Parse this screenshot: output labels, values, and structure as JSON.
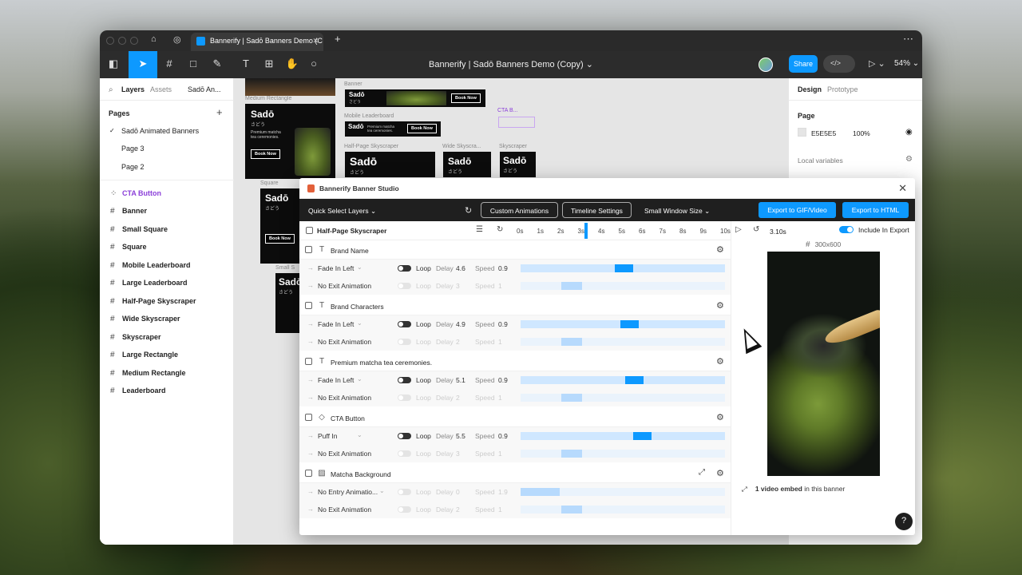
{
  "browser": {
    "tab_title": "Bannerify | Sadō Banners Demo (C",
    "tab_close": "✕",
    "new_tab": "+",
    "more": "⋯"
  },
  "toolbar": {
    "doc_title": "Bannerify | Sadō Banners Demo (Copy) ⌄",
    "share": "Share",
    "code": "</>",
    "zoom": "54% ⌄"
  },
  "left_panel": {
    "tabs": [
      "Layers",
      "Assets",
      "Sadō An..."
    ],
    "pages_title": "Pages",
    "pages": [
      "Sadō Animated Banners",
      "Page 3",
      "Page 2"
    ],
    "layers": [
      "CTA Button",
      "Banner",
      "Small Square",
      "Square",
      "Mobile Leaderboard",
      "Large Leaderboard",
      "Half-Page Skyscraper",
      "Wide Skyscraper",
      "Skyscraper",
      "Large Rectangle",
      "Medium Rectangle",
      "Leaderboard"
    ]
  },
  "canvas": {
    "labels": {
      "medium_rectangle": "Medium Rectangle",
      "banner": "Banner",
      "mobile_leaderboard": "Mobile Leaderboard",
      "half_page": "Half-Page Skyscraper",
      "wide_sky": "Wide Skyscra...",
      "skyscraper": "Skyscraper",
      "square": "Square",
      "small_sq": "Small S",
      "cta": "CTA B..."
    },
    "brand": "Sadō",
    "brand_sub": "さどう",
    "tagline": "Premium matcha tea ceremonies.",
    "book_now": "Book Now"
  },
  "right_panel": {
    "tabs": [
      "Design",
      "Prototype"
    ],
    "page_title": "Page",
    "bg_hex": "E5E5E5",
    "bg_opacity": "100%",
    "local_vars": "Local variables"
  },
  "studio": {
    "title": "Bannerify Banner Studio",
    "quick_select": "Quick Select Layers ⌄",
    "custom_animations": "Custom Animations",
    "timeline_settings": "Timeline Settings",
    "window_size": "Small Window Size ⌄",
    "export_gif": "Export to GIF/Video",
    "export_html": "Export to HTML",
    "timeline_name": "Half-Page Skyscraper",
    "ticks": [
      "0s",
      "1s",
      "2s",
      "3s",
      "4s",
      "5s",
      "6s",
      "7s",
      "8s",
      "9s",
      "10s"
    ],
    "current_time": "3.10s",
    "include_export": "Include In Export",
    "layers": [
      {
        "name": "Brand Name",
        "icon": "T",
        "entry": {
          "name": "Fade In Left",
          "loop": "Loop",
          "delay_label": "Delay",
          "delay": "4.6",
          "speed_label": "Speed",
          "speed": "0.9",
          "start": 0.46,
          "dur": 0.09
        },
        "exit": {
          "name": "No Exit Animation",
          "loop": "Loop",
          "delay_label": "Delay",
          "delay": "3",
          "speed_label": "Speed",
          "speed": "1",
          "start": 0.2,
          "dur": 0.1
        }
      },
      {
        "name": "Brand Characters",
        "icon": "T",
        "entry": {
          "name": "Fade In Left",
          "loop": "Loop",
          "delay_label": "Delay",
          "delay": "4.9",
          "speed_label": "Speed",
          "speed": "0.9",
          "start": 0.49,
          "dur": 0.09
        },
        "exit": {
          "name": "No Exit Animation",
          "loop": "Loop",
          "delay_label": "Delay",
          "delay": "2",
          "speed_label": "Speed",
          "speed": "1",
          "start": 0.2,
          "dur": 0.1
        }
      },
      {
        "name": "Premium matcha tea ceremonies.",
        "icon": "T",
        "entry": {
          "name": "Fade In Left",
          "loop": "Loop",
          "delay_label": "Delay",
          "delay": "5.1",
          "speed_label": "Speed",
          "speed": "0.9",
          "start": 0.51,
          "dur": 0.09
        },
        "exit": {
          "name": "No Exit Animation",
          "loop": "Loop",
          "delay_label": "Delay",
          "delay": "2",
          "speed_label": "Speed",
          "speed": "1",
          "start": 0.2,
          "dur": 0.1
        }
      },
      {
        "name": "CTA Button",
        "icon": "◇",
        "entry": {
          "name": "Puff In",
          "loop": "Loop",
          "delay_label": "Delay",
          "delay": "5.5",
          "speed_label": "Speed",
          "speed": "0.9",
          "start": 0.55,
          "dur": 0.09
        },
        "exit": {
          "name": "No Exit Animation",
          "loop": "Loop",
          "delay_label": "Delay",
          "delay": "3",
          "speed_label": "Speed",
          "speed": "1",
          "start": 0.2,
          "dur": 0.1
        }
      },
      {
        "name": "Matcha Background",
        "icon": "▨",
        "entry": {
          "name": "No Entry Animatio...",
          "loop": "Loop",
          "delay_label": "Delay",
          "delay": "0",
          "speed_label": "Speed",
          "speed": "1.9",
          "start": 0.0,
          "dur": 0.19
        },
        "exit": {
          "name": "No Exit Animation",
          "loop": "Loop",
          "delay_label": "Delay",
          "delay": "2",
          "speed_label": "Speed",
          "speed": "1",
          "start": 0.2,
          "dur": 0.1
        }
      }
    ],
    "preview_size": "300x600",
    "embed_strong": "1 video embed",
    "embed_rest": " in this banner",
    "help": "?"
  }
}
